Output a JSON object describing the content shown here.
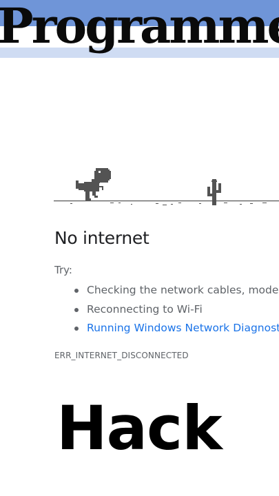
{
  "overlay": {
    "title": "Programmer",
    "caption": "Hack"
  },
  "error_page": {
    "heading": "No internet",
    "try_label": "Try:",
    "suggestions": [
      "Checking the network cables, modem, and router",
      "Reconnecting to Wi-Fi"
    ],
    "diagnostics_link": "Running Windows Network Diagnostics",
    "error_code": "ERR_INTERNET_DISCONNECTED"
  },
  "colors": {
    "title_band": "#6f95d8",
    "heading_text": "#202124",
    "secondary_text": "#5f6368",
    "link": "#1a73e8",
    "dino": "#535353"
  },
  "icons": {
    "dino": "t-rex-dino-icon",
    "cactus": "cactus-icon"
  }
}
